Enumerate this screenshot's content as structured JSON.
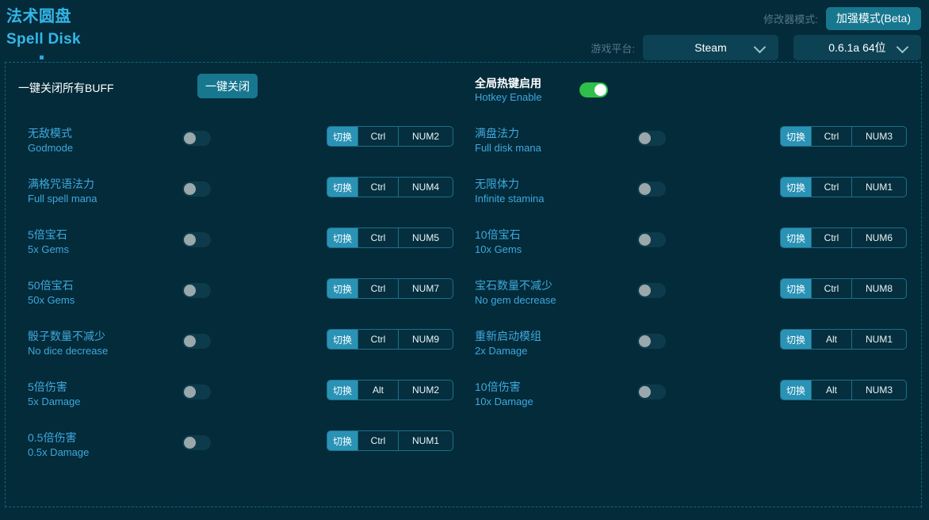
{
  "header": {
    "title_cn": "法术圆盘",
    "title_en": "Spell Disk",
    "mode_label": "修改器模式:",
    "mode_value": "加强模式(Beta)",
    "platform_label": "游戏平台:",
    "platform_value": "Steam",
    "version_value": "0.6.1a 64位",
    "chevron_icon": "chevron-down-icon"
  },
  "colors": {
    "background": "#032b3a",
    "accent": "#35b6e8",
    "button": "#17778f",
    "toggle_on": "#2ec04a",
    "toggle_off": "#0d3b4c",
    "chip_action": "#2a93b5",
    "panel_border": "#19627c"
  },
  "top_row": {
    "buff_label": "一键关闭所有BUFF",
    "buff_button": "一键关闭",
    "hotkey_cn": "全局热键启用",
    "hotkey_en": "Hotkey Enable",
    "hotkey_state": "on"
  },
  "left_column": [
    {
      "cn": "无敌模式",
      "en": "Godmode",
      "state": "off",
      "action": "切换",
      "mod": "Ctrl",
      "key": "NUM2"
    },
    {
      "cn": "满格咒语法力",
      "en": "Full spell mana",
      "state": "off",
      "action": "切换",
      "mod": "Ctrl",
      "key": "NUM4"
    },
    {
      "cn": "5倍宝石",
      "en": "5x Gems",
      "state": "off",
      "action": "切换",
      "mod": "Ctrl",
      "key": "NUM5"
    },
    {
      "cn": "50倍宝石",
      "en": "50x Gems",
      "state": "off",
      "action": "切换",
      "mod": "Ctrl",
      "key": "NUM7"
    },
    {
      "cn": "骰子数量不减少",
      "en": "No dice decrease",
      "state": "off",
      "action": "切换",
      "mod": "Ctrl",
      "key": "NUM9"
    },
    {
      "cn": "5倍伤害",
      "en": "5x Damage",
      "state": "off",
      "action": "切换",
      "mod": "Alt",
      "key": "NUM2"
    },
    {
      "cn": "0.5倍伤害",
      "en": "0.5x Damage",
      "state": "off",
      "action": "切换",
      "mod": "Ctrl",
      "key": "NUM1"
    }
  ],
  "right_column": [
    {
      "cn": "满盘法力",
      "en": "Full disk mana",
      "state": "off",
      "action": "切换",
      "mod": "Ctrl",
      "key": "NUM3"
    },
    {
      "cn": "无限体力",
      "en": "Infinite stamina",
      "state": "off",
      "action": "切换",
      "mod": "Ctrl",
      "key": "NUM1"
    },
    {
      "cn": "10倍宝石",
      "en": "10x Gems",
      "state": "off",
      "action": "切换",
      "mod": "Ctrl",
      "key": "NUM6"
    },
    {
      "cn": "宝石数量不减少",
      "en": "No gem decrease",
      "state": "off",
      "action": "切换",
      "mod": "Ctrl",
      "key": "NUM8"
    },
    {
      "cn": "重新启动模组",
      "en": "2x Damage",
      "state": "off",
      "action": "切换",
      "mod": "Alt",
      "key": "NUM1"
    },
    {
      "cn": "10倍伤害",
      "en": "10x Damage",
      "state": "off",
      "action": "切换",
      "mod": "Alt",
      "key": "NUM3"
    }
  ]
}
